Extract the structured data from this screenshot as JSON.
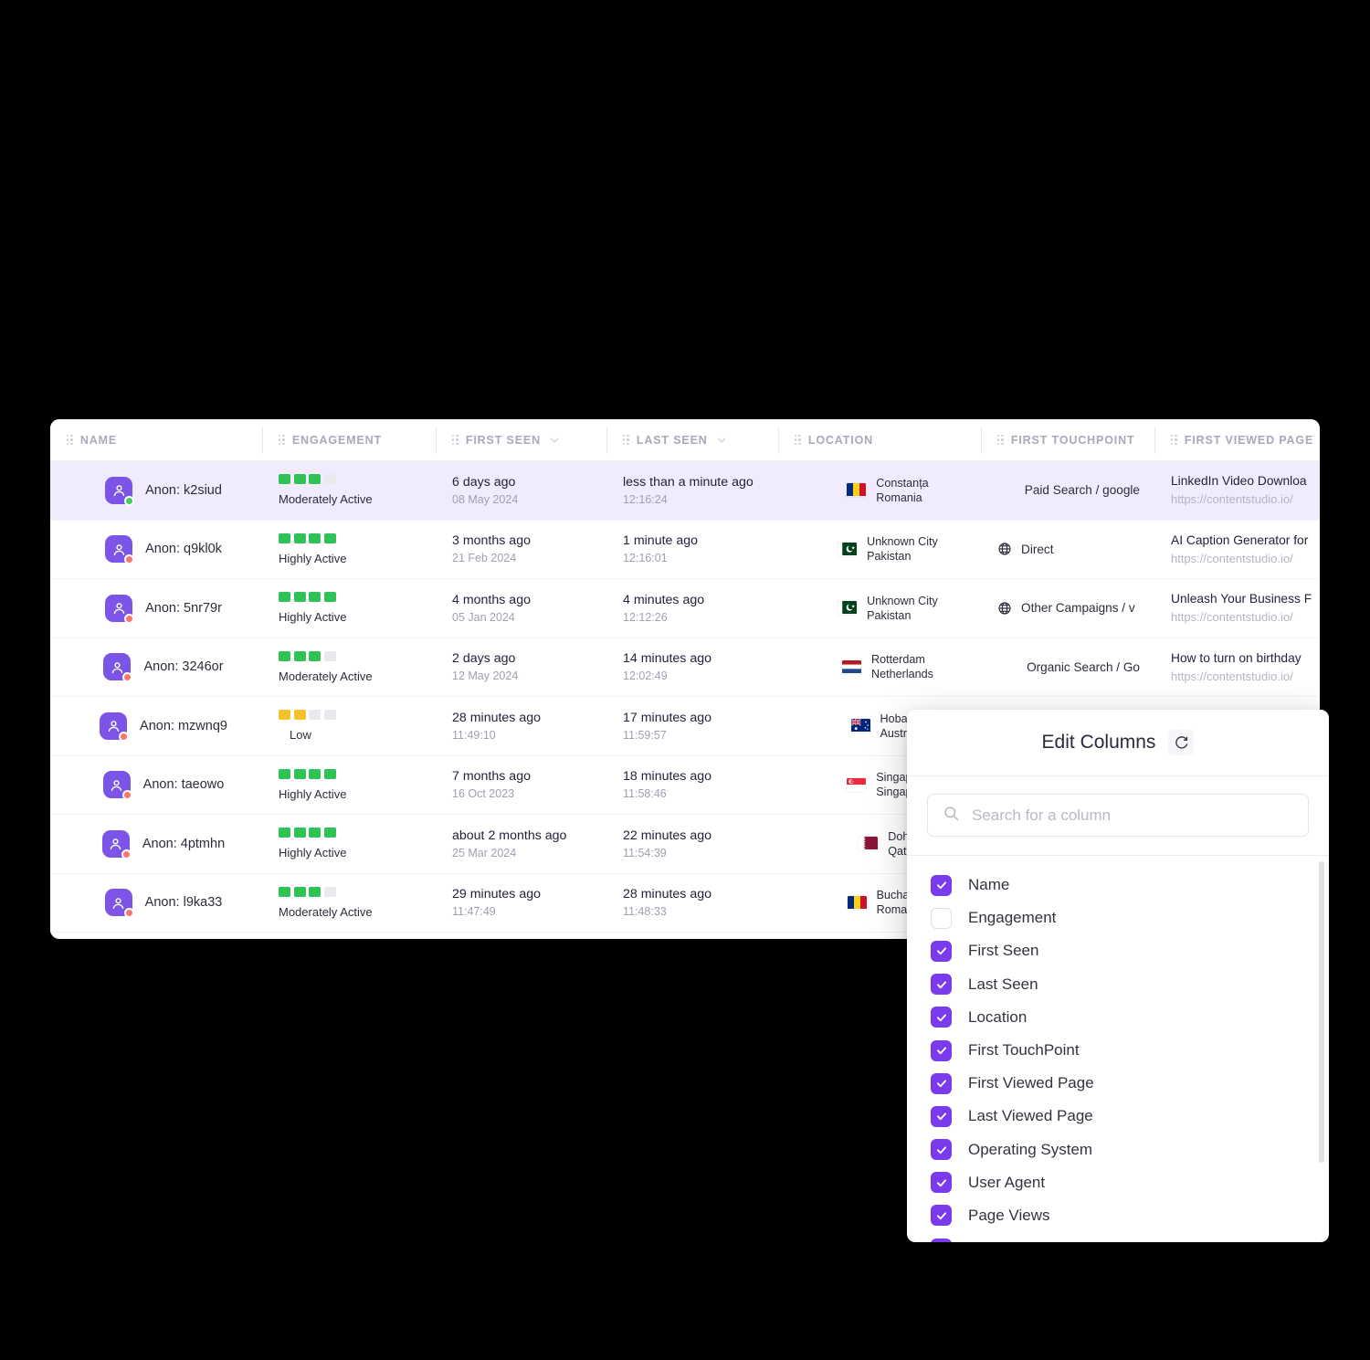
{
  "table": {
    "columns": [
      {
        "key": "name",
        "label": "NAME",
        "handle": "drag-handle-icon",
        "sortable": false
      },
      {
        "key": "eng",
        "label": "ENGAGEMENT",
        "handle": "drag-handle-icon",
        "sortable": false
      },
      {
        "key": "first",
        "label": "FIRST SEEN",
        "handle": "drag-handle-icon",
        "sortable": true
      },
      {
        "key": "last",
        "label": "LAST SEEN",
        "handle": "drag-handle-icon",
        "sortable": true
      },
      {
        "key": "loc",
        "label": "LOCATION",
        "handle": "drag-handle-icon",
        "sortable": false
      },
      {
        "key": "touch",
        "label": "FIRST TOUCHPOINT",
        "handle": "drag-handle-icon",
        "sortable": false
      },
      {
        "key": "page",
        "label": "FIRST VIEWED PAGE",
        "handle": "drag-handle-icon",
        "sortable": false
      }
    ],
    "rows": [
      {
        "selected": true,
        "name": "Anon: k2siud",
        "status": "online",
        "engagement_level": 3,
        "engagement_color": "green",
        "engagement_label": "Moderately Active",
        "first_seen": "6 days ago",
        "first_seen_date": "08 May 2024",
        "last_seen": "less than a minute ago",
        "last_seen_time": "12:16:24",
        "flag": "ro",
        "city": "Constanța",
        "country": "Romania",
        "touchpoint": "Paid Search / google",
        "touchpoint_icon": false,
        "page_title": "LinkedIn Video Downloa",
        "page_url": "https://contentstudio.io/"
      },
      {
        "selected": false,
        "name": "Anon: q9kl0k",
        "status": "offline",
        "engagement_level": 4,
        "engagement_color": "green",
        "engagement_label": "Highly Active",
        "first_seen": "3 months ago",
        "first_seen_date": "21 Feb 2024",
        "last_seen": "1 minute ago",
        "last_seen_time": "12:16:01",
        "flag": "pk",
        "city": "Unknown City",
        "country": "Pakistan",
        "touchpoint": "Direct",
        "touchpoint_icon": true,
        "page_title": "AI Caption Generator for",
        "page_url": "https://contentstudio.io/"
      },
      {
        "selected": false,
        "name": "Anon: 5nr79r",
        "status": "offline",
        "engagement_level": 4,
        "engagement_color": "green",
        "engagement_label": "Highly Active",
        "first_seen": "4 months ago",
        "first_seen_date": "05 Jan 2024",
        "last_seen": "4 minutes ago",
        "last_seen_time": "12:12:26",
        "flag": "pk",
        "city": "Unknown City",
        "country": "Pakistan",
        "touchpoint": "Other Campaigns / v",
        "touchpoint_icon": true,
        "page_title": "Unleash Your Business F",
        "page_url": "https://contentstudio.io/"
      },
      {
        "selected": false,
        "name": "Anon: 3246or",
        "status": "offline",
        "engagement_level": 3,
        "engagement_color": "green",
        "engagement_label": "Moderately Active",
        "first_seen": "2 days ago",
        "first_seen_date": "12 May 2024",
        "last_seen": "14 minutes ago",
        "last_seen_time": "12:02:49",
        "flag": "nl",
        "city": "Rotterdam",
        "country": "Netherlands",
        "touchpoint": "Organic Search / Go",
        "touchpoint_icon": false,
        "page_title": "How to turn on birthday",
        "page_url": "https://contentstudio.io/"
      },
      {
        "selected": false,
        "name": "Anon: mzwnq9",
        "status": "offline",
        "engagement_level": 2,
        "engagement_color": "yellow",
        "engagement_label": "Low",
        "first_seen": "28 minutes ago",
        "first_seen_date": "11:49:10",
        "last_seen": "17 minutes ago",
        "last_seen_time": "11:59:57",
        "flag": "au",
        "city": "Hobart",
        "country": "Australia",
        "touchpoint": "",
        "touchpoint_icon": false,
        "page_title": "",
        "page_url": ""
      },
      {
        "selected": false,
        "name": "Anon: taeowo",
        "status": "offline",
        "engagement_level": 4,
        "engagement_color": "green",
        "engagement_label": "Highly Active",
        "first_seen": "7 months ago",
        "first_seen_date": "16 Oct 2023",
        "last_seen": "18 minutes ago",
        "last_seen_time": "11:58:46",
        "flag": "sg",
        "city": "Singapore",
        "country": "Singapore",
        "touchpoint": "",
        "touchpoint_icon": false,
        "page_title": "",
        "page_url": ""
      },
      {
        "selected": false,
        "name": "Anon: 4ptmhn",
        "status": "offline",
        "engagement_level": 4,
        "engagement_color": "green",
        "engagement_label": "Highly Active",
        "first_seen": "about 2 months ago",
        "first_seen_date": "25 Mar 2024",
        "last_seen": "22 minutes ago",
        "last_seen_time": "11:54:39",
        "flag": "qa",
        "city": "Doha",
        "country": "Qatar",
        "touchpoint": "",
        "touchpoint_icon": false,
        "page_title": "",
        "page_url": ""
      },
      {
        "selected": false,
        "name": "Anon: l9ka33",
        "status": "offline",
        "engagement_level": 3,
        "engagement_color": "green",
        "engagement_label": "Moderately Active",
        "first_seen": "29 minutes ago",
        "first_seen_date": "11:47:49",
        "last_seen": "28 minutes ago",
        "last_seen_time": "11:48:33",
        "flag": "ro",
        "city": "Bucharest",
        "country": "Romania",
        "touchpoint": "",
        "touchpoint_icon": false,
        "page_title": "",
        "page_url": ""
      }
    ]
  },
  "edit_columns_panel": {
    "title": "Edit Columns",
    "reset_icon": "refresh-icon",
    "search": {
      "placeholder": "Search for a column",
      "value": "",
      "icon": "search-icon"
    },
    "options": [
      {
        "label": "Name",
        "checked": true
      },
      {
        "label": "Engagement",
        "checked": false
      },
      {
        "label": "First Seen",
        "checked": true
      },
      {
        "label": "Last Seen",
        "checked": true
      },
      {
        "label": "Location",
        "checked": true
      },
      {
        "label": "First TouchPoint",
        "checked": true
      },
      {
        "label": "First Viewed Page",
        "checked": true
      },
      {
        "label": "Last Viewed Page",
        "checked": true
      },
      {
        "label": "Operating System",
        "checked": true
      },
      {
        "label": "User Agent",
        "checked": true
      },
      {
        "label": "Page Views",
        "checked": true
      },
      {
        "label": "",
        "checked": true
      }
    ]
  },
  "colors": {
    "accent": "#7c3aed",
    "avatar": "#7c55e8",
    "row_selected": "#f0ecfd",
    "engagement_green": "#2fc254",
    "engagement_yellow": "#f5c22b",
    "engagement_empty": "#e9e9ee",
    "status_online": "#3ecf5a",
    "status_offline": "#f8766e",
    "background": "#000000"
  }
}
